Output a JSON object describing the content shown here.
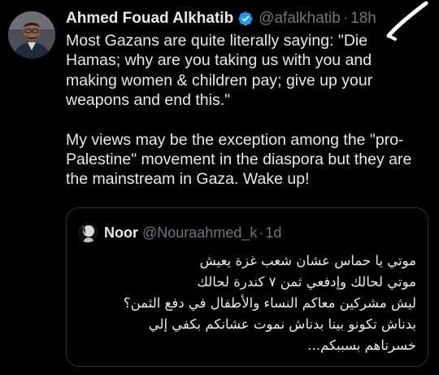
{
  "tweet": {
    "display_name": "Ahmed Fouad Alkhatib",
    "handle": "@afalkhatib",
    "separator": "·",
    "time": "18h",
    "text_paragraphs": [
      "Most Gazans are quite literally saying: \"Die\nHamas; why are you taking us with you and\nmaking women & children pay; give up your\nweapons and end this.\"",
      "My views may be the exception among the \"pro-\nPalestine\" movement in the diaspora but they are\nthe mainstream in Gaza. Wake up!"
    ],
    "verified_icon": "verified-badge-icon",
    "colors": {
      "background": "#000000",
      "text": "#e7e9ea",
      "secondary": "#71767b",
      "verified": "#1d9bf0",
      "border": "#2f3336"
    }
  },
  "quote": {
    "display_name": "Noor",
    "handle": "@Nouraahmed_k",
    "separator": "·",
    "time": "1d",
    "lines": [
      "موتي يا حماس عشان شعب غزة يعيش",
      "موتي لحالك وإدفعي ثمن ٧ كندرة  لحالك",
      "ليش مشركين معاكم النساء والأطفال في دفع الثمن؟",
      "بدناش تكونو بينا بدناش نموت عشانكم بكفي إلي",
      "خسرناهم بسببكم..."
    ]
  }
}
